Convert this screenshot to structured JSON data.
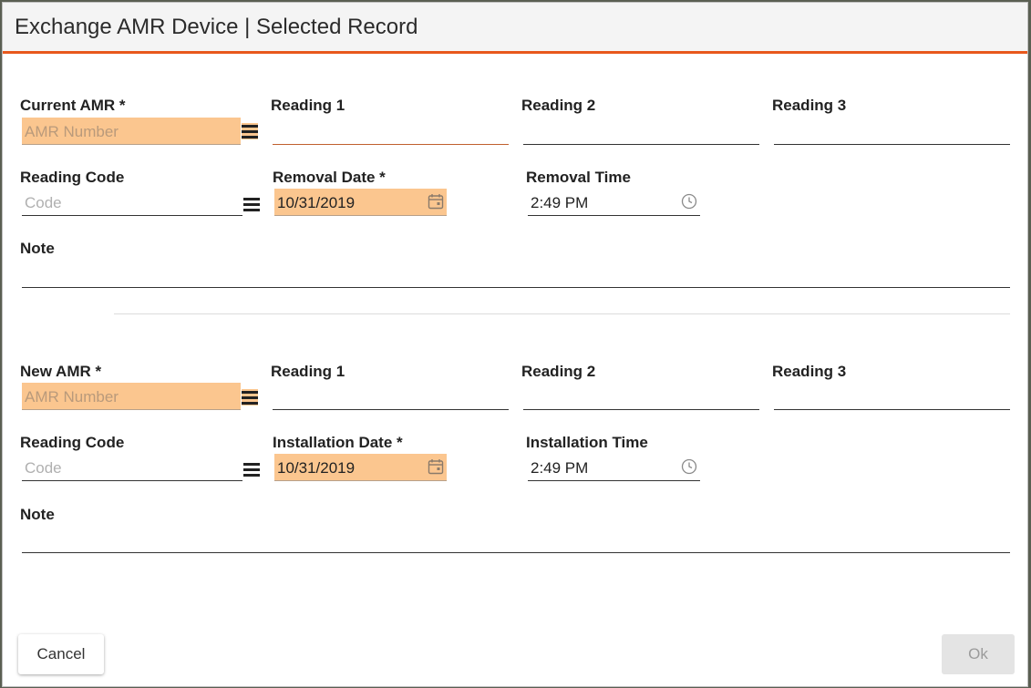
{
  "dialog": {
    "title": "Exchange AMR Device | Selected Record"
  },
  "current": {
    "amr_label": "Current AMR *",
    "amr_placeholder": "AMR Number",
    "reading1_label": "Reading 1",
    "reading2_label": "Reading 2",
    "reading3_label": "Reading 3",
    "reading_code_label": "Reading Code",
    "reading_code_placeholder": "Code",
    "date_label": "Removal Date *",
    "date_value": "10/31/2019",
    "time_label": "Removal Time",
    "time_value": "2:49 PM",
    "note_label": "Note"
  },
  "new": {
    "amr_label": "New AMR *",
    "amr_placeholder": "AMR Number",
    "reading1_label": "Reading 1",
    "reading2_label": "Reading 2",
    "reading3_label": "Reading 3",
    "reading_code_label": "Reading Code",
    "reading_code_placeholder": "Code",
    "date_label": "Installation Date *",
    "date_value": "10/31/2019",
    "time_label": "Installation Time",
    "time_value": "2:49 PM",
    "note_label": "Note"
  },
  "buttons": {
    "cancel": "Cancel",
    "ok": "Ok"
  },
  "colors": {
    "accent": "#e8581c",
    "required_fill": "#fbc68f",
    "disabled_button": "#e4e4e4"
  },
  "icons": [
    "menu-icon",
    "calendar-icon",
    "clock-icon"
  ]
}
